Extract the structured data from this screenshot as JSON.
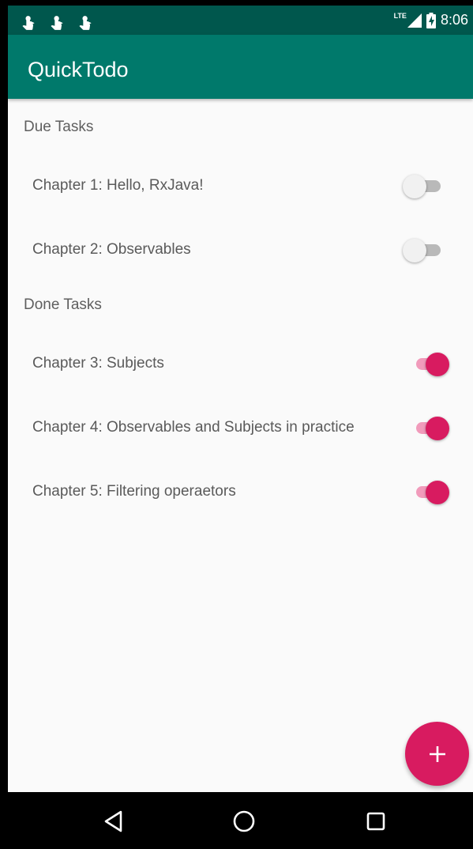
{
  "status_bar": {
    "left_icons": [
      "touch-icon",
      "touch-icon",
      "touch-icon"
    ],
    "network": "LTE",
    "time": "8:06"
  },
  "app_bar": {
    "title": "QuickTodo"
  },
  "sections": [
    {
      "header": "Due Tasks",
      "tasks": [
        {
          "label": "Chapter 1: Hello, RxJava!",
          "done": false
        },
        {
          "label": "Chapter 2: Observables",
          "done": false
        }
      ]
    },
    {
      "header": "Done Tasks",
      "tasks": [
        {
          "label": "Chapter 3: Subjects",
          "done": true
        },
        {
          "label": "Chapter 4: Observables and Subjects in practice",
          "done": true
        },
        {
          "label": "Chapter 5: Filtering operaetors",
          "done": true
        }
      ]
    }
  ],
  "fab": {
    "icon": "plus-icon"
  },
  "nav_bar": {
    "icons": [
      "back-icon",
      "home-icon",
      "recents-icon"
    ]
  },
  "colors": {
    "status_bar": "#00574d",
    "app_bar": "#00796b",
    "accent": "#d81b60",
    "accent_track": "#f19bbb",
    "background": "#fafafa"
  }
}
